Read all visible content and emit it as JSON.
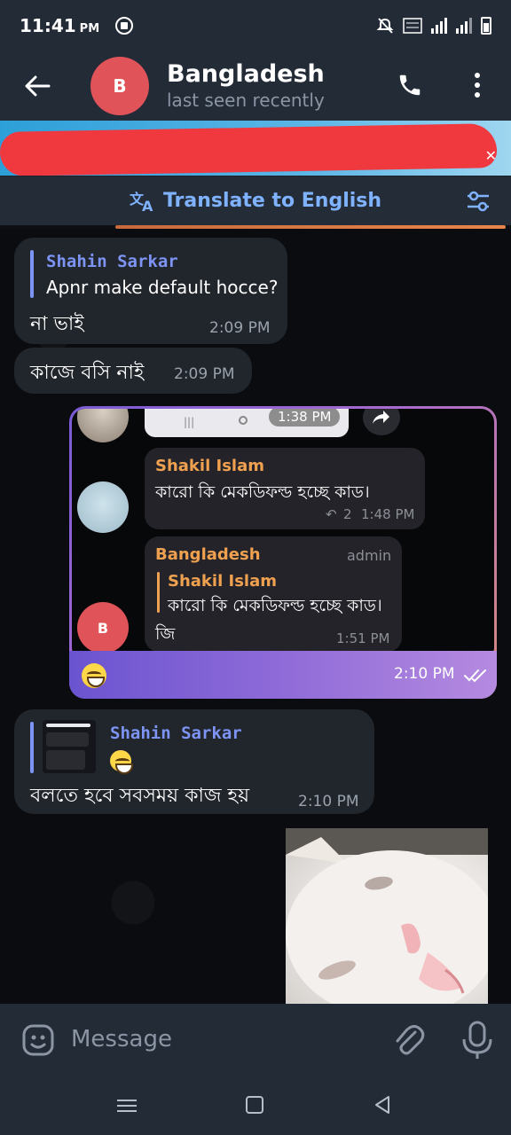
{
  "status_bar": {
    "time": "11:41",
    "ampm": "PM"
  },
  "header": {
    "avatar_letter": "B",
    "title": "Bangladesh",
    "subtitle": "last seen recently"
  },
  "translate_bar": {
    "label": "Translate to English"
  },
  "messages": [
    {
      "reply_name": "Shahin Sarkar",
      "reply_text": "Apnr make default hocce?",
      "text": "না ভাই",
      "time": "2:09 PM"
    },
    {
      "text": "কাজে বসি নাই",
      "time": "2:09 PM"
    },
    {
      "screenshot": {
        "time_pill": "1:38 PM",
        "msg1": {
          "name": "Shakil Islam",
          "text": "কারো কি মেকডিফল্ড হচ্ছে কাড।",
          "replies": "2",
          "time": "1:48 PM"
        },
        "msg2": {
          "name": "Bangladesh",
          "role": "admin",
          "reply_name": "Shakil Islam",
          "reply_text": "কারো কি মেকডিফল্ড হচ্ছে কাড।",
          "text": "জি",
          "time": "1:51 PM",
          "avatar_letter": "B"
        }
      },
      "time": "2:10 PM"
    },
    {
      "reply_name": "Shahin Sarkar",
      "text": "বলতে হবে সবসময় কাজ হয়",
      "time": "2:10 PM"
    }
  ],
  "input": {
    "placeholder": "Message"
  },
  "colors": {
    "accent": "#7fb2ff",
    "header_bg": "#232b37",
    "avatar": "#e05358",
    "outgoing_gradient_start": "#6b54d0",
    "outgoing_gradient_end": "#b58ae0"
  }
}
